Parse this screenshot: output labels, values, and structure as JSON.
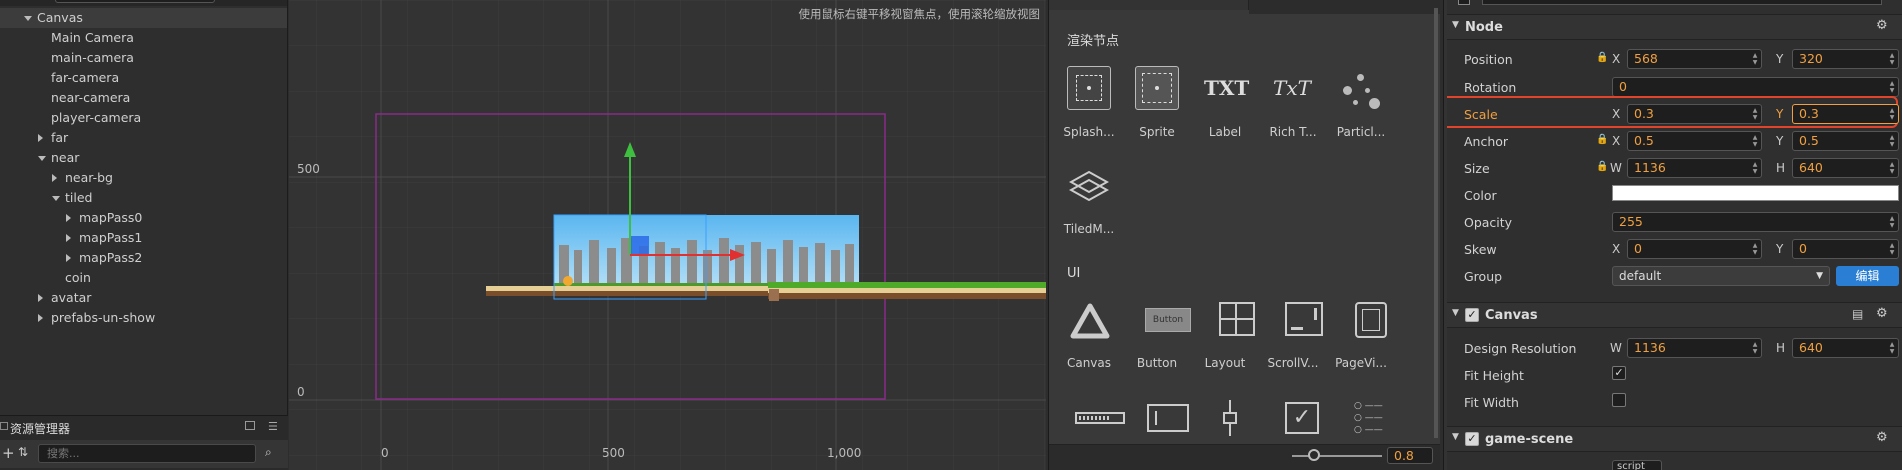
{
  "hierarchy": {
    "items": [
      {
        "label": "Canvas",
        "level": 0,
        "expanded": true,
        "selected": true
      },
      {
        "label": "Main Camera",
        "level": 1
      },
      {
        "label": "main-camera",
        "level": 1
      },
      {
        "label": "far-camera",
        "level": 1
      },
      {
        "label": "near-camera",
        "level": 1
      },
      {
        "label": "player-camera",
        "level": 1
      },
      {
        "label": "far",
        "level": 1,
        "expandable": true
      },
      {
        "label": "near",
        "level": 1,
        "expanded": true
      },
      {
        "label": "near-bg",
        "level": 2,
        "expandable": true
      },
      {
        "label": "tiled",
        "level": 2,
        "expanded": true
      },
      {
        "label": "mapPass0",
        "level": 3,
        "expandable": true
      },
      {
        "label": "mapPass1",
        "level": 3,
        "expandable": true
      },
      {
        "label": "mapPass2",
        "level": 3,
        "expandable": true
      },
      {
        "label": "coin",
        "level": 2
      },
      {
        "label": "avatar",
        "level": 1,
        "expandable": true
      },
      {
        "label": "prefabs-un-show",
        "level": 1,
        "expandable": true
      }
    ]
  },
  "assets": {
    "title": "资源管理器",
    "search_placeholder": "搜索..."
  },
  "scene": {
    "hint": "使用鼠标右键平移视窗焦点，使用滚轮缩放视图",
    "y_labels": [
      "500",
      "0"
    ],
    "x_labels": [
      "0",
      "500",
      "1,000"
    ]
  },
  "components": {
    "render_title": "渲染节点",
    "render_items": [
      {
        "label": "Splash...",
        "icon": "splash-icon"
      },
      {
        "label": "Sprite",
        "icon": "sprite-icon"
      },
      {
        "label": "Label",
        "icon": "label-icon"
      },
      {
        "label": "Rich T...",
        "icon": "richtext-icon"
      },
      {
        "label": "Particl...",
        "icon": "particle-icon"
      },
      {
        "label": "TiledM...",
        "icon": "tiledmap-icon"
      }
    ],
    "ui_title": "UI",
    "ui_items": [
      {
        "label": "Canvas",
        "icon": "canvas-icon"
      },
      {
        "label": "Button",
        "icon": "button-icon"
      },
      {
        "label": "Layout",
        "icon": "layout-icon"
      },
      {
        "label": "ScrollV...",
        "icon": "scrollview-icon"
      },
      {
        "label": "PageVi...",
        "icon": "pageview-icon"
      }
    ],
    "zoom_value": "0.8"
  },
  "inspector": {
    "node_title": "Node",
    "position": {
      "label": "Position",
      "x_axis": "X",
      "x": "568",
      "y_axis": "Y",
      "y": "320"
    },
    "rotation": {
      "label": "Rotation",
      "value": "0"
    },
    "scale": {
      "label": "Scale",
      "x_axis": "X",
      "x": "0.3",
      "y_axis": "Y",
      "y": "0.3"
    },
    "anchor": {
      "label": "Anchor",
      "x_axis": "X",
      "x": "0.5",
      "y_axis": "Y",
      "y": "0.5"
    },
    "size": {
      "label": "Size",
      "w_axis": "W",
      "w": "1136",
      "h_axis": "H",
      "h": "640"
    },
    "color": {
      "label": "Color",
      "value": "#ffffff"
    },
    "opacity": {
      "label": "Opacity",
      "value": "255"
    },
    "skew": {
      "label": "Skew",
      "x_axis": "X",
      "x": "0",
      "y_axis": "Y",
      "y": "0"
    },
    "group": {
      "label": "Group",
      "value": "default",
      "edit_button": "编辑"
    },
    "canvas_title": "Canvas",
    "design_resolution": {
      "label": "Design Resolution",
      "w_axis": "W",
      "w": "1136",
      "h_axis": "H",
      "h": "640"
    },
    "fit_height": {
      "label": "Fit Height",
      "checked": true
    },
    "fit_width": {
      "label": "Fit Width",
      "checked": false
    },
    "game_scene_title": "game-scene",
    "script_badge": "script"
  },
  "colors": {
    "highlight": "#e0442b",
    "edit_button": "#2a7fd4",
    "number_text": "#f0a040",
    "gizmo_green": "#3fbf3f",
    "gizmo_red": "#e03030",
    "canvas_frame": "#8a2a8a"
  }
}
